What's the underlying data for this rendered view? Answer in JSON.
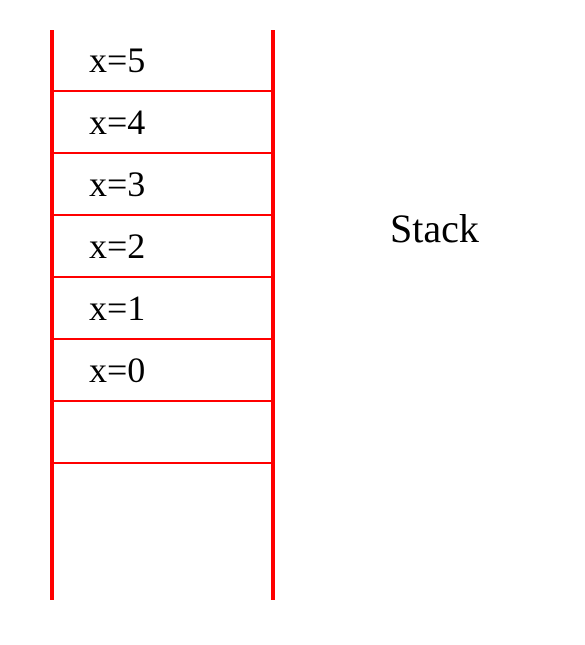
{
  "stack": {
    "cells": [
      {
        "label": "x=5"
      },
      {
        "label": "x=4"
      },
      {
        "label": "x=3"
      },
      {
        "label": "x=2"
      },
      {
        "label": "x=1"
      },
      {
        "label": "x=0"
      },
      {
        "label": ""
      }
    ]
  },
  "label": "Stack"
}
